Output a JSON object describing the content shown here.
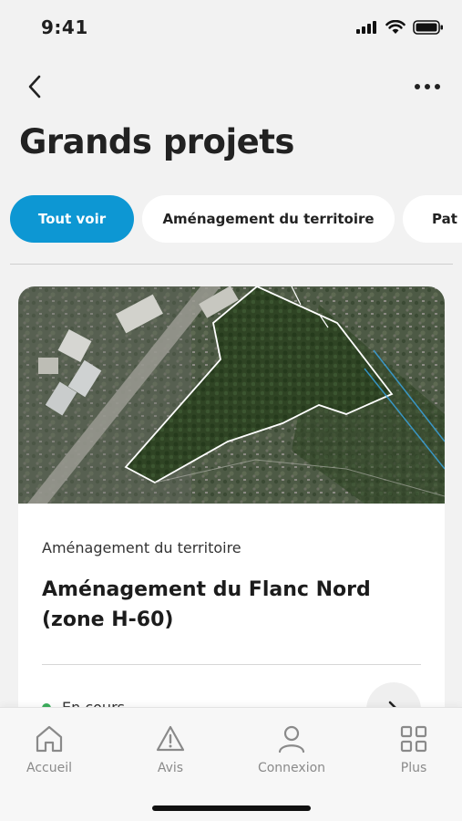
{
  "status_bar": {
    "time": "9:41"
  },
  "header": {
    "title": "Grands projets"
  },
  "filters": {
    "chips": [
      {
        "label": "Tout voir",
        "active": true
      },
      {
        "label": "Aménagement du territoire",
        "active": false
      },
      {
        "label": "Pat",
        "active": false
      }
    ]
  },
  "card": {
    "category": "Aménagement du territoire",
    "title": "Aménagement du Flanc Nord (zone H-60)",
    "status": "En cours",
    "status_color": "#3cae5c"
  },
  "tab_bar": {
    "tabs": [
      {
        "label": "Accueil",
        "icon": "home-icon"
      },
      {
        "label": "Avis",
        "icon": "warning-icon"
      },
      {
        "label": "Connexion",
        "icon": "user-icon"
      },
      {
        "label": "Plus",
        "icon": "grid-icon"
      }
    ]
  },
  "colors": {
    "accent": "#0d97d3",
    "background": "#f2f2f2"
  }
}
